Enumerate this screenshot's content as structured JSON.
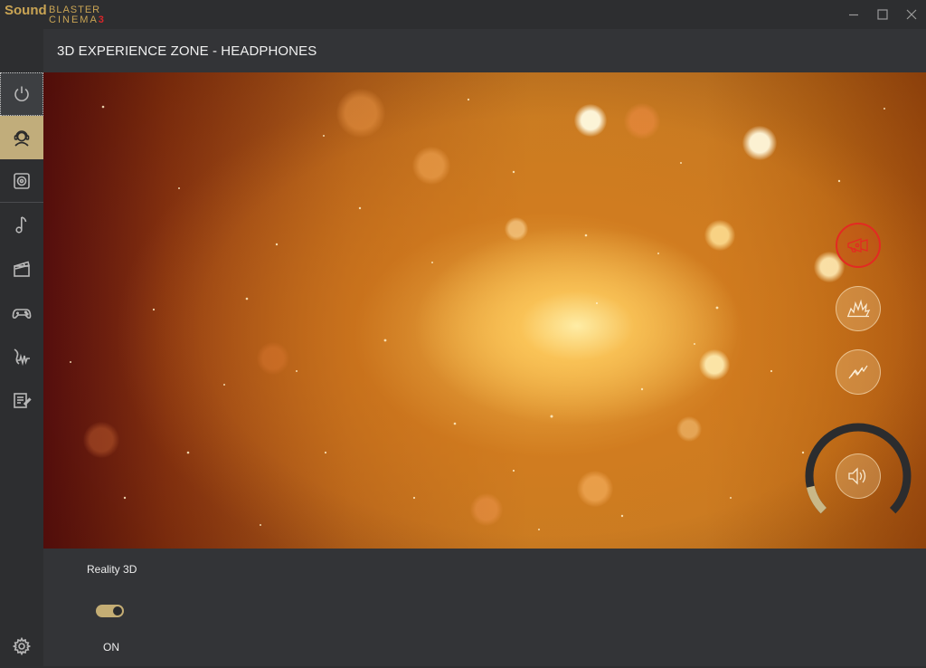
{
  "app": {
    "logo_word1": "Sound",
    "logo_word2": "BLASTER",
    "logo_word3": "CINEMA",
    "logo_number": "3",
    "brand_color": "#c9a454",
    "accent_red": "#e32a22"
  },
  "window_controls": {
    "minimize_icon": "minimize-icon",
    "maximize_icon": "maximize-icon",
    "close_icon": "close-icon"
  },
  "sidebar": {
    "items": [
      {
        "icon": "power-icon",
        "state": "focused"
      },
      {
        "icon": "headphones-user-icon",
        "state": "active"
      },
      {
        "icon": "speaker-icon",
        "state": "normal"
      },
      {
        "icon": "music-note-icon",
        "state": "normal"
      },
      {
        "icon": "clapperboard-icon",
        "state": "normal"
      },
      {
        "icon": "gamepad-icon",
        "state": "normal"
      },
      {
        "icon": "voice-waveform-icon",
        "state": "normal"
      },
      {
        "icon": "notes-edit-icon",
        "state": "normal"
      }
    ],
    "settings_icon": "gear-icon",
    "active_color": "#c1ad7b"
  },
  "header": {
    "title": "3D EXPERIENCE ZONE - HEADPHONES"
  },
  "visual": {
    "controls": [
      {
        "icon": "megaphone-icon",
        "state": "selected"
      },
      {
        "icon": "explosion-icon",
        "state": "normal"
      },
      {
        "icon": "zigzag-arrow-icon",
        "state": "normal"
      },
      {
        "icon": "speaker-volume-icon",
        "state": "normal"
      }
    ],
    "dial_level": 0.12
  },
  "bottom": {
    "feature_label": "Reality 3D",
    "toggle_state": "ON",
    "toggle_on": true
  }
}
